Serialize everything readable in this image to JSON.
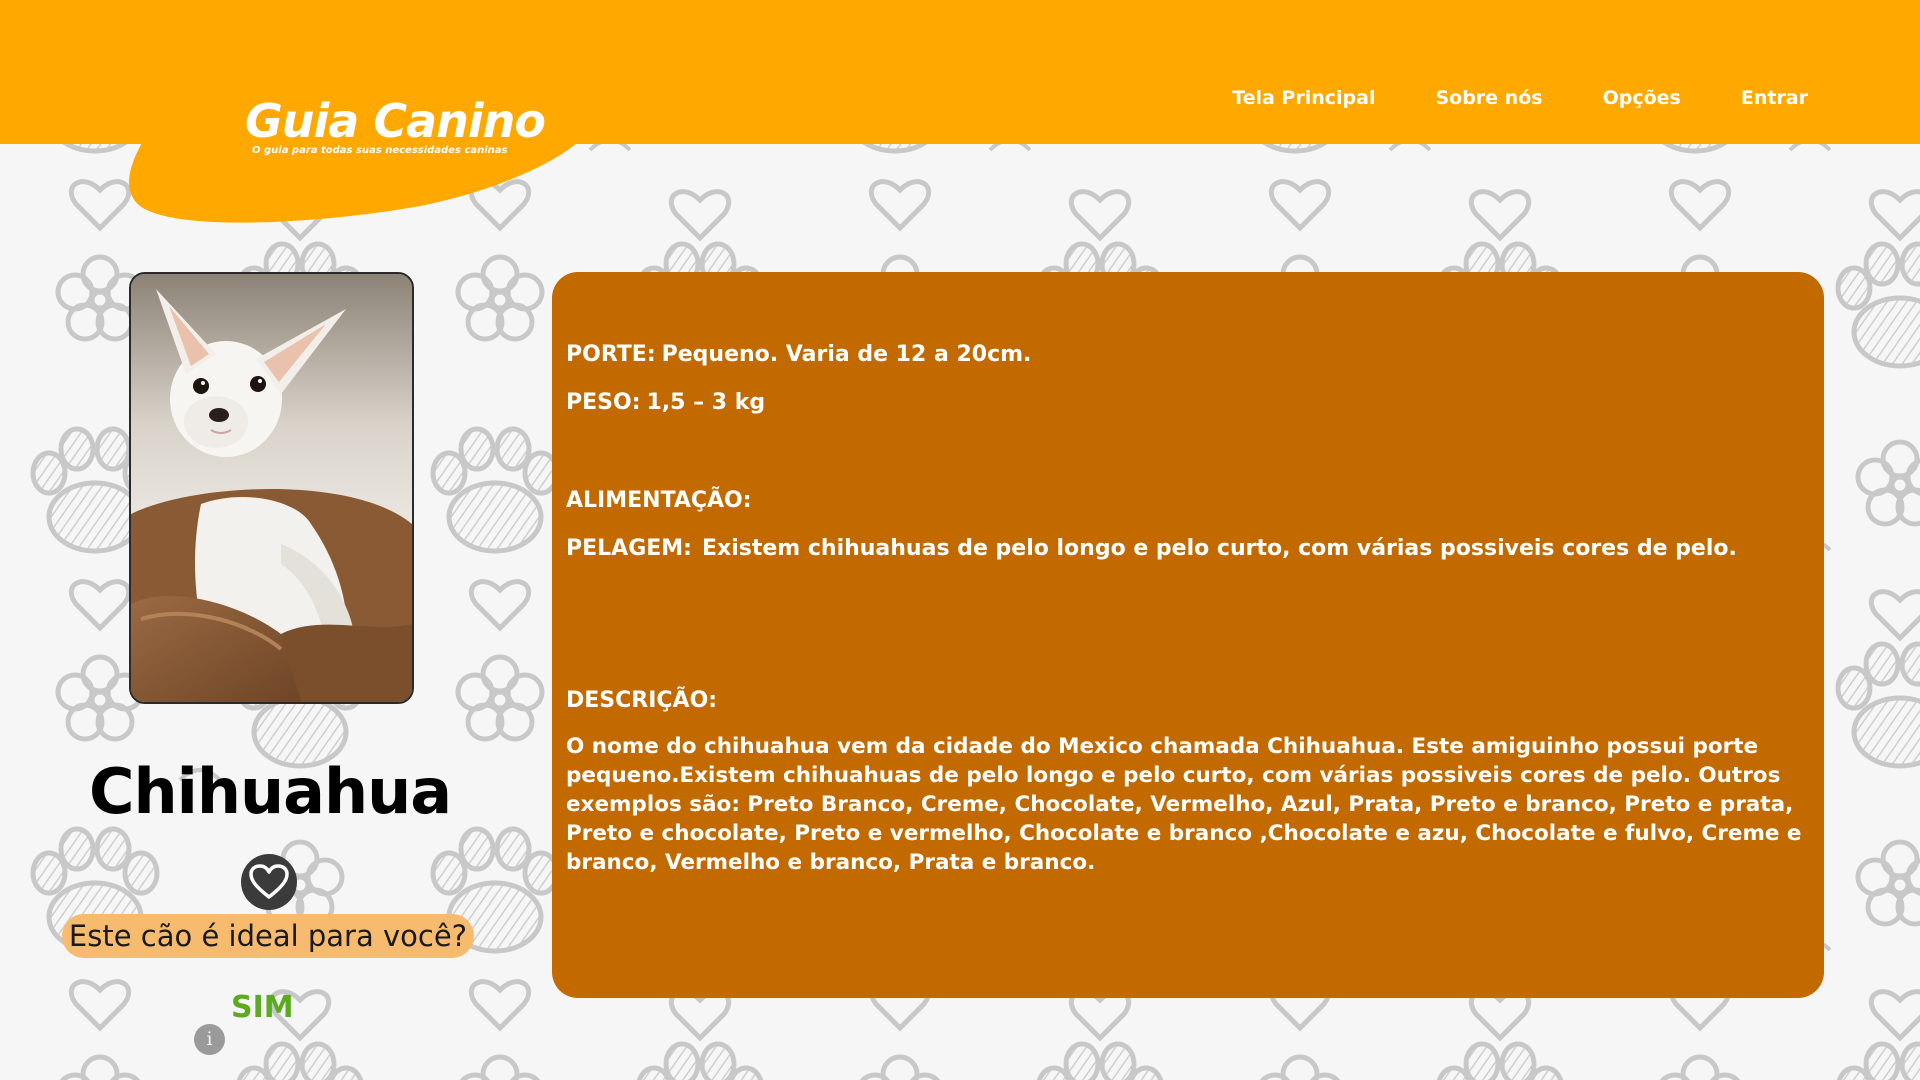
{
  "header": {
    "brand_title": "Guia Canino",
    "brand_tagline": "O guia para todas suas necessidades caninas",
    "nav": [
      "Tela Principal",
      "Sobre nós",
      "Opções",
      "Entrar"
    ]
  },
  "breed": {
    "name": "Chihuahua",
    "photo_alt": "Chihuahua branco sentado em uma caminha"
  },
  "match": {
    "question": "Este cão é ideal para você?",
    "answer": "SIM"
  },
  "details": {
    "porte_label": "PORTE:",
    "porte_value": "Pequeno. Varia de 12 a 20cm.",
    "peso_label": "PESO:",
    "peso_value": "1,5 – 3 kg",
    "alimentacao_label": "ALIMENTAÇÃO:",
    "alimentacao_value": "",
    "pelagem_label": "PELAGEM:",
    "pelagem_value": "Existem chihuahuas de pelo longo e pelo curto, com várias possiveis cores de pelo.",
    "descricao_label": "DESCRIÇÃO:",
    "descricao_value": "O nome do chihuahua vem da cidade do Mexico chamada Chihuahua. Este amiguinho possui porte pequeno.Existem chihuahuas de pelo longo e pelo curto, com várias possiveis cores de pelo. Outros exemplos são: Preto Branco, Creme, Chocolate, Vermelho, Azul, Prata, Preto e branco, Preto e prata, Preto e chocolate, Preto e vermelho, Chocolate e branco ,Chocolate e azu, Chocolate e fulvo, Creme e branco, Vermelho e branco, Prata e branco."
  },
  "icons": {
    "favorite": "heart-icon",
    "info": "info-icon"
  },
  "colors": {
    "header": "#ffa800",
    "panel": "#c26a00",
    "question_bg": "#f7bb6f",
    "answer": "#5aab1e"
  }
}
